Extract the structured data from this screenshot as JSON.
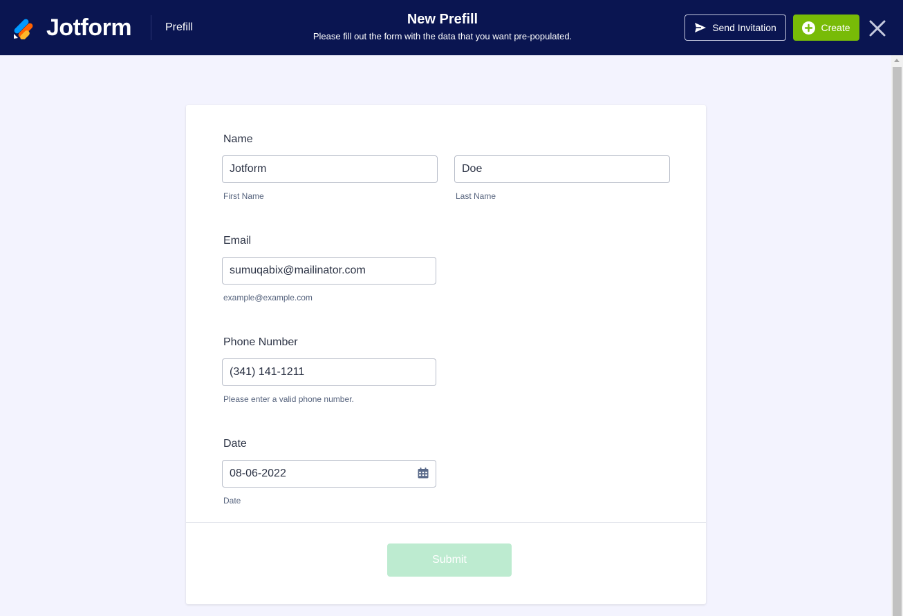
{
  "header": {
    "brand": "Jotform",
    "breadcrumb": "Prefill",
    "title": "New Prefill",
    "subtitle": "Please fill out the form with the data that you want pre-populated.",
    "send_invitation_label": "Send Invitation",
    "create_label": "Create"
  },
  "colors": {
    "header_bg": "#0a1551",
    "create_button": "#78bb07",
    "submit_button": "#bdebd0",
    "page_bg": "#f3f3fe"
  },
  "form": {
    "name": {
      "label": "Name",
      "first_value": "Jotform",
      "first_sublabel": "First Name",
      "last_value": "Doe",
      "last_sublabel": "Last Name"
    },
    "email": {
      "label": "Email",
      "value": "sumuqabix@mailinator.com",
      "sublabel": "example@example.com"
    },
    "phone": {
      "label": "Phone Number",
      "value": "(341) 141-1211",
      "sublabel": "Please enter a valid phone number."
    },
    "date": {
      "label": "Date",
      "value": "08-06-2022",
      "sublabel": "Date",
      "icon": "calendar-icon"
    },
    "submit_label": "Submit"
  }
}
